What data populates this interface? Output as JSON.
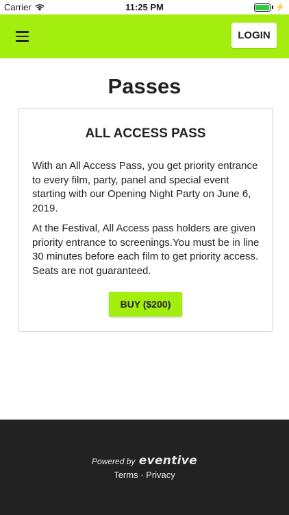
{
  "status_bar": {
    "carrier": "Carrier",
    "time": "11:25 PM"
  },
  "header": {
    "menu_icon": "hamburger-menu-icon",
    "login_label": "LOGIN",
    "background_color": "#a4ee0f"
  },
  "main": {
    "title": "Passes",
    "card": {
      "title": "ALL ACCESS PASS",
      "paragraphs": [
        "With an All Access Pass, you get priority entrance to every film, party, panel and special event starting with our Opening Night Party on June 6, 2019.",
        "At the Festival, All Access pass holders are given priority entrance to screenings.You must be in line 30 minutes before each film to get priority access. Seats are not guaranteed."
      ],
      "buy_label": "BUY ($200)"
    }
  },
  "footer": {
    "powered_by": "Powered by",
    "brand": "eventive",
    "terms": "Terms",
    "separator": "·",
    "privacy": "Privacy",
    "background_color": "#222222"
  }
}
